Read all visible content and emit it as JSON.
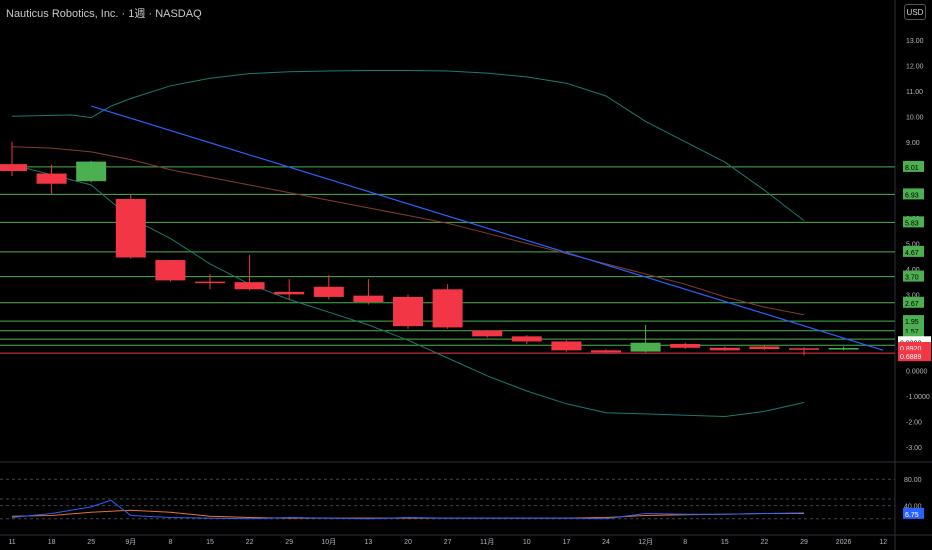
{
  "header": {
    "company": "Nauticus Robotics, Inc.",
    "interval": "1週",
    "exchange": "NASDAQ",
    "separator": " · ",
    "currency_button": "USD"
  },
  "colors": {
    "up": "#4caf50",
    "down": "#f23645",
    "level_line": "#4caf50",
    "band": "#1b7a6e",
    "trend": "#2962ff",
    "ma": "#8b3a2e",
    "rsi": "#2962ff",
    "rsi_ma": "#e8762c"
  },
  "chart_data": {
    "type": "candlestick",
    "x_ticks": [
      "11",
      "18",
      "25",
      "9月",
      "8",
      "15",
      "22",
      "29",
      "10月",
      "13",
      "20",
      "27",
      "11月",
      "10",
      "17",
      "24",
      "12月",
      "8",
      "15",
      "22",
      "29",
      "2026",
      "12"
    ],
    "y_ticks": [
      "13.00",
      "12.00",
      "11.00",
      "10.00",
      "9.00",
      "8.00",
      "7.00",
      "6.00",
      "5.00",
      "4.00",
      "3.00",
      "2.00",
      "1.00",
      "0.0000",
      "-1.0000",
      "-2.00",
      "-3.00"
    ],
    "ylim": [
      -3.4,
      13.6
    ],
    "candles": [
      {
        "x": 0,
        "o": 8.12,
        "h": 9.0,
        "l": 7.65,
        "c": 7.85
      },
      {
        "x": 1,
        "o": 7.75,
        "h": 8.1,
        "l": 6.95,
        "c": 7.35
      },
      {
        "x": 2,
        "o": 7.45,
        "h": 8.25,
        "l": 7.4,
        "c": 8.22
      },
      {
        "x": 3,
        "o": 6.75,
        "h": 6.95,
        "l": 4.4,
        "c": 4.45
      },
      {
        "x": 4,
        "o": 4.35,
        "h": 4.35,
        "l": 3.5,
        "c": 3.55
      },
      {
        "x": 5,
        "o": 3.5,
        "h": 3.8,
        "l": 3.2,
        "c": 3.45
      },
      {
        "x": 6,
        "o": 3.48,
        "h": 4.55,
        "l": 3.15,
        "c": 3.2
      },
      {
        "x": 7,
        "o": 3.1,
        "h": 3.6,
        "l": 2.8,
        "c": 3.0
      },
      {
        "x": 8,
        "o": 3.3,
        "h": 3.75,
        "l": 2.8,
        "c": 2.9
      },
      {
        "x": 9,
        "o": 2.95,
        "h": 3.6,
        "l": 2.6,
        "c": 2.7
      },
      {
        "x": 10,
        "o": 2.9,
        "h": 3.0,
        "l": 1.65,
        "c": 1.75
      },
      {
        "x": 11,
        "o": 3.2,
        "h": 3.4,
        "l": 1.65,
        "c": 1.7
      },
      {
        "x": 12,
        "o": 1.58,
        "h": 1.6,
        "l": 1.3,
        "c": 1.35
      },
      {
        "x": 13,
        "o": 1.35,
        "h": 1.4,
        "l": 1.05,
        "c": 1.15
      },
      {
        "x": 14,
        "o": 1.15,
        "h": 1.2,
        "l": 0.75,
        "c": 0.8
      },
      {
        "x": 15,
        "o": 0.8,
        "h": 0.85,
        "l": 0.68,
        "c": 0.72
      },
      {
        "x": 16,
        "o": 0.75,
        "h": 1.8,
        "l": 0.72,
        "c": 1.1
      },
      {
        "x": 17,
        "o": 1.05,
        "h": 1.1,
        "l": 0.85,
        "c": 0.9
      },
      {
        "x": 18,
        "o": 0.9,
        "h": 0.95,
        "l": 0.78,
        "c": 0.8
      },
      {
        "x": 19,
        "o": 0.95,
        "h": 1.0,
        "l": 0.82,
        "c": 0.85
      },
      {
        "x": 20,
        "o": 0.88,
        "h": 0.92,
        "l": 0.6,
        "c": 0.85
      },
      {
        "x": 21,
        "o": 0.88,
        "h": 0.95,
        "l": 0.8,
        "c": 0.89
      }
    ],
    "level_labels": [
      "8.01",
      "6.93",
      "5.83",
      "4.67",
      "3.70",
      "2.67",
      "1.95",
      "1.57",
      "1.24"
    ],
    "last_price_labels": [
      {
        "label": "0.9993",
        "value": 0.9993,
        "style": "white"
      },
      {
        "label": "0.8920",
        "value": 0.892,
        "style": "red"
      },
      {
        "label": "0.6889",
        "value": 0.6889,
        "style": "red"
      }
    ],
    "band_upper": [
      [
        0,
        10.0
      ],
      [
        1.5,
        10.05
      ],
      [
        2,
        9.95
      ],
      [
        2.5,
        10.4
      ],
      [
        3,
        10.7
      ],
      [
        4,
        11.2
      ],
      [
        5,
        11.5
      ],
      [
        6,
        11.68
      ],
      [
        7,
        11.75
      ],
      [
        8,
        11.78
      ],
      [
        9,
        11.8
      ],
      [
        10,
        11.8
      ],
      [
        11,
        11.78
      ],
      [
        12,
        11.7
      ],
      [
        13,
        11.55
      ],
      [
        14,
        11.3
      ],
      [
        15,
        10.8
      ],
      [
        16,
        9.8
      ],
      [
        17,
        9.0
      ],
      [
        18,
        8.2
      ],
      [
        19,
        7.1
      ],
      [
        20,
        5.9
      ]
    ],
    "band_lower": [
      [
        0,
        8.1
      ],
      [
        1,
        7.7
      ],
      [
        2,
        7.3
      ],
      [
        3,
        6.0
      ],
      [
        4,
        5.2
      ],
      [
        5,
        4.2
      ],
      [
        6,
        3.4
      ],
      [
        7,
        2.8
      ],
      [
        8,
        2.3
      ],
      [
        9,
        1.8
      ],
      [
        10,
        1.2
      ],
      [
        11,
        0.5
      ],
      [
        12,
        -0.2
      ],
      [
        13,
        -0.8
      ],
      [
        14,
        -1.3
      ],
      [
        15,
        -1.65
      ],
      [
        16,
        -1.7
      ],
      [
        17,
        -1.75
      ],
      [
        18,
        -1.8
      ],
      [
        19,
        -1.6
      ],
      [
        20,
        -1.25
      ]
    ],
    "moving_average": [
      [
        0,
        8.8
      ],
      [
        1,
        8.75
      ],
      [
        2,
        8.6
      ],
      [
        3,
        8.3
      ],
      [
        4,
        7.9
      ],
      [
        5,
        7.6
      ],
      [
        6,
        7.3
      ],
      [
        7,
        7.0
      ],
      [
        8,
        6.7
      ],
      [
        9,
        6.4
      ],
      [
        10,
        6.1
      ],
      [
        11,
        5.8
      ],
      [
        12,
        5.4
      ],
      [
        13,
        5.0
      ],
      [
        14,
        4.6
      ],
      [
        15,
        4.2
      ],
      [
        16,
        3.8
      ],
      [
        17,
        3.4
      ],
      [
        18,
        2.9
      ],
      [
        19,
        2.5
      ],
      [
        20,
        2.2
      ]
    ],
    "trend_line": [
      [
        2,
        10.4
      ],
      [
        22,
        0.8
      ]
    ],
    "rsi": {
      "ticks": [
        "80.00",
        "40.00"
      ],
      "ylim": [
        0,
        100
      ],
      "rsi_values": [
        [
          0,
          22
        ],
        [
          1,
          28
        ],
        [
          2,
          38
        ],
        [
          2.5,
          48
        ],
        [
          3,
          25
        ],
        [
          4,
          22
        ],
        [
          5,
          21
        ],
        [
          6,
          20
        ],
        [
          7,
          22
        ],
        [
          8,
          21
        ],
        [
          9,
          20
        ],
        [
          10,
          22
        ],
        [
          11,
          21
        ],
        [
          12,
          21
        ],
        [
          13,
          21
        ],
        [
          14,
          21
        ],
        [
          15,
          20
        ],
        [
          16,
          28
        ],
        [
          17,
          27
        ],
        [
          18,
          27
        ],
        [
          19,
          28
        ],
        [
          20,
          29
        ]
      ],
      "ma_values": [
        [
          0,
          24
        ],
        [
          1,
          25
        ],
        [
          2,
          30
        ],
        [
          3,
          33
        ],
        [
          4,
          30
        ],
        [
          5,
          24
        ],
        [
          6,
          22
        ],
        [
          7,
          21
        ],
        [
          8,
          21
        ],
        [
          9,
          21
        ],
        [
          10,
          21
        ],
        [
          11,
          21
        ],
        [
          12,
          21
        ],
        [
          13,
          21
        ],
        [
          14,
          21
        ],
        [
          15,
          22
        ],
        [
          16,
          25
        ],
        [
          17,
          26
        ],
        [
          18,
          27
        ],
        [
          19,
          28
        ],
        [
          20,
          28
        ]
      ],
      "last_label": "6.75"
    }
  }
}
